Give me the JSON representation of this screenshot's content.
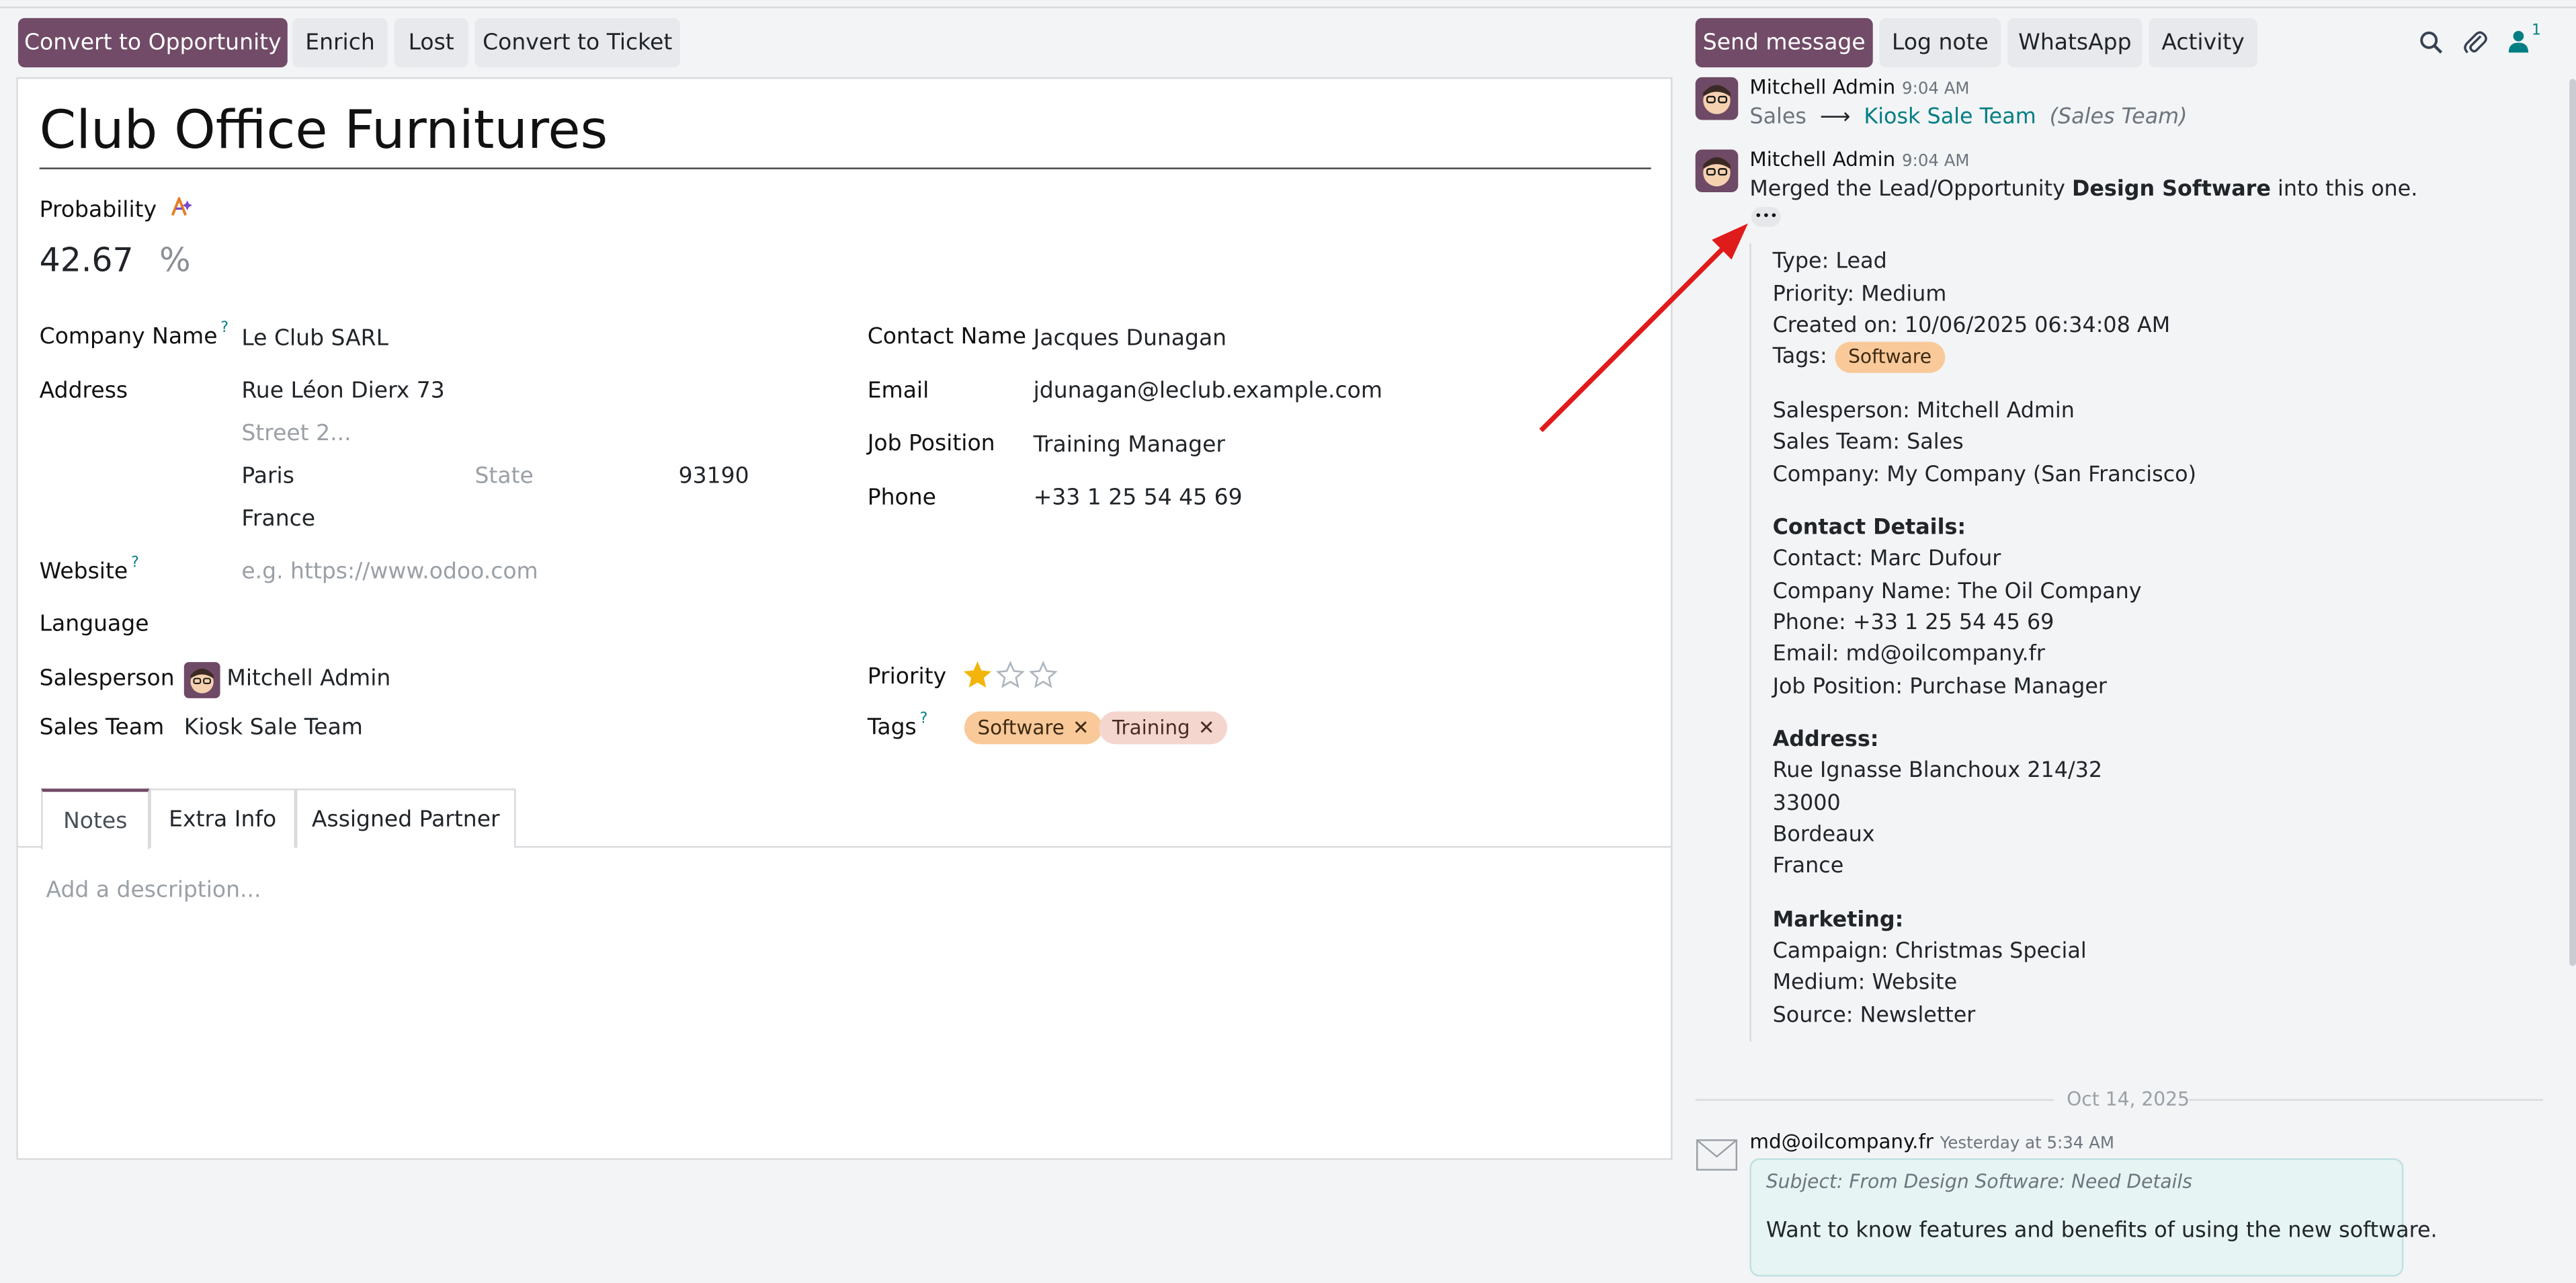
{
  "control_panel": {
    "convert_opportunity": "Convert to Opportunity",
    "enrich": "Enrich",
    "lost": "Lost",
    "convert_ticket": "Convert to Ticket"
  },
  "form": {
    "title": "Club Office Furnitures",
    "probability_label": "Probability",
    "probability_value": "42.67",
    "probability_unit": "%",
    "company_name_label": "Company Name",
    "company_name_value": "Le Club SARL",
    "address_label": "Address",
    "street": "Rue Léon Dierx 73",
    "street2_placeholder": "Street 2...",
    "city": "Paris",
    "state_placeholder": "State",
    "zip": "93190",
    "country": "France",
    "website_label": "Website",
    "website_placeholder": "e.g. https://www.odoo.com",
    "language_label": "Language",
    "salesperson_label": "Salesperson",
    "salesperson_value": "Mitchell Admin",
    "sales_team_label": "Sales Team",
    "sales_team_value": "Kiosk Sale Team",
    "contact_name_label": "Contact Name",
    "contact_name_value": "Jacques Dunagan",
    "email_label": "Email",
    "email_value": "jdunagan@leclub.example.com",
    "job_position_label": "Job Position",
    "job_position_value": "Training Manager",
    "phone_label": "Phone",
    "phone_value": "+33 1 25 54 45 69",
    "priority_label": "Priority",
    "priority_stars": 1,
    "priority_max": 3,
    "tags_label": "Tags",
    "tags": [
      "Software",
      "Training"
    ],
    "tag_remove_glyph": "✕",
    "tabs": [
      "Notes",
      "Extra Info",
      "Assigned Partner"
    ],
    "notes_placeholder": "Add a description..."
  },
  "chatter": {
    "send_message": "Send message",
    "log_note": "Log note",
    "whatsapp": "WhatsApp",
    "activity": "Activity",
    "follower_count": "1",
    "msg1": {
      "author": "Mitchell Admin",
      "time": "9:04 AM",
      "from": "Sales",
      "arrow": "⟶",
      "to": "Kiosk Sale Team",
      "field": "(Sales Team)"
    },
    "msg2": {
      "author": "Mitchell Admin",
      "time": "9:04 AM",
      "text_pre": "Merged the Lead/Opportunity ",
      "text_bold": "Design Software",
      "text_post": " into this one.",
      "expand": "•••",
      "type": "Type: Lead",
      "priority": "Priority: Medium",
      "created": "Created on: 10/06/2025 06:34:08 AM",
      "tags_label": "Tags:",
      "tag": "Software",
      "salesperson": "Salesperson: Mitchell Admin",
      "sales_team": "Sales Team: Sales",
      "company": "Company: My Company (San Francisco)",
      "contact_header": "Contact Details:",
      "contact": "Contact: Marc Dufour",
      "company_name": "Company Name: The Oil Company",
      "phone": "Phone: +33 1 25 54 45 69",
      "email": "Email: md@oilcompany.fr",
      "job": "Job Position: Purchase Manager",
      "address_header": "Address:",
      "addr1": "Rue Ignasse Blanchoux 214/32",
      "addr2": "33000",
      "addr3": "Bordeaux",
      "addr4": "France",
      "marketing_header": "Marketing:",
      "campaign": "Campaign: Christmas Special",
      "medium": "Medium: Website",
      "source": "Source: Newsletter"
    },
    "date_separator": "Oct 14, 2025",
    "msg3": {
      "author": "md@oilcompany.fr",
      "time": "Yesterday at 5:34 AM",
      "subject": "Subject: From Design Software: Need Details",
      "body": "Want to know features and benefits of using the new software."
    }
  },
  "colors": {
    "primary": "#714b67",
    "link": "#017e84",
    "annotation_arrow": "#e01b1b",
    "star": "#f3b50b"
  }
}
